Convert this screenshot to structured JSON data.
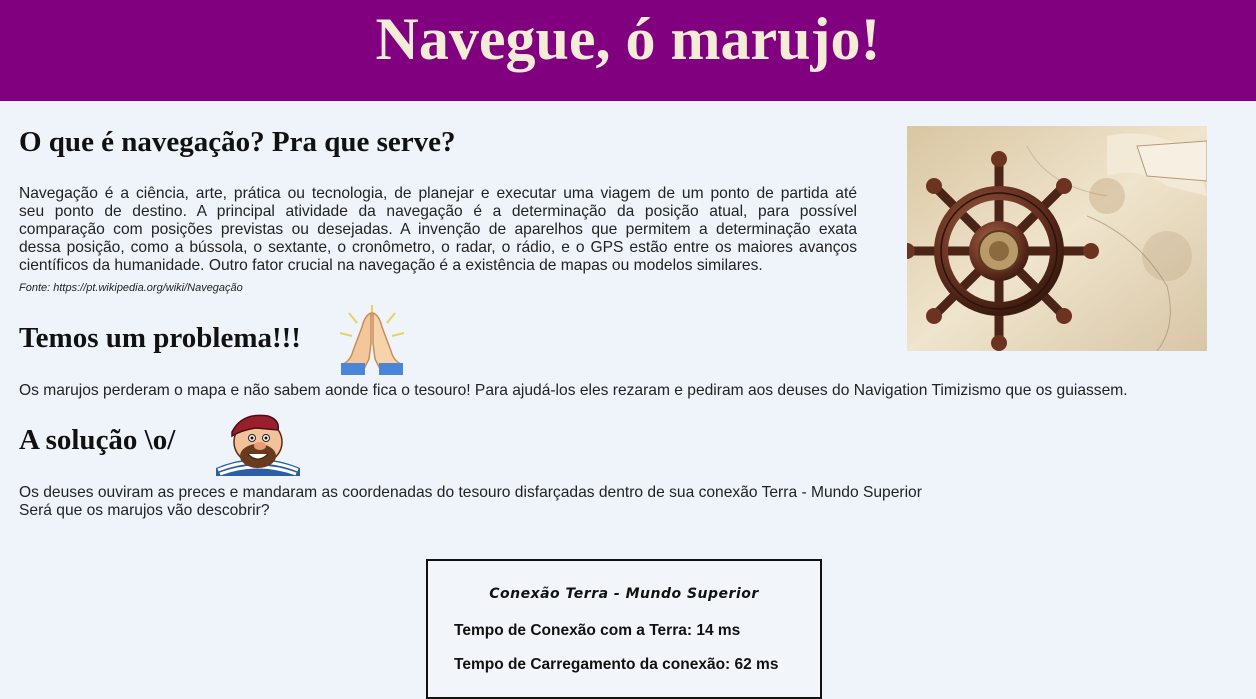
{
  "header": {
    "title": "Navegue, ó marujo!"
  },
  "section1": {
    "heading": "O que é navegação? Pra que serve?",
    "lines": [
      "Navegação é a ciência, arte, prática ou tecnologia, de planejar e executar uma viagem de um ponto de partida até",
      "seu ponto de destino. A principal atividade da navegação é a determinação da posição atual, para possível",
      "comparação com posições previstas ou desejadas. A invenção de aparelhos que permitem a determinação exata",
      "dessa posição, como a bússola, o sextante, o cronômetro, o radar, o rádio, e o GPS estão entre os maiores avanços",
      "científicos da humanidade. Outro fator crucial na navegação é a existência de mapas ou modelos similares."
    ],
    "source": "Fonte: https://pt.wikipedia.org/wiki/Navegação",
    "image_icon": "ship-wheel-on-map-image"
  },
  "section2": {
    "heading": "Temos um problema!!!",
    "icon": "praying-hands-icon",
    "text": "Os marujos perderam o mapa e não sabem aonde fica o tesouro! Para ajudá-los eles rezaram e pediram aos deuses do Navigation Timizismo que os guiassem."
  },
  "section3": {
    "heading": "A solução \\o/",
    "icon": "pirate-icon",
    "line1": "Os deuses ouviram as preces e mandaram as coordenadas do tesouro disfarçadas dentro de sua conexão Terra - Mundo Superior",
    "line2": "Será que os marujos vão descobrir?"
  },
  "connection_box": {
    "title": "Conexão Terra - Mundo Superior",
    "connection_time_label": "Tempo de Conexão com a Terra: ",
    "connection_time_value": "14 ms",
    "load_time_label": "Tempo de Carregamento da conexão: ",
    "load_time_value": "62 ms"
  },
  "colors": {
    "header_bg": "#800080",
    "header_text": "#f4ecd6",
    "page_bg": "#eff4fb"
  }
}
